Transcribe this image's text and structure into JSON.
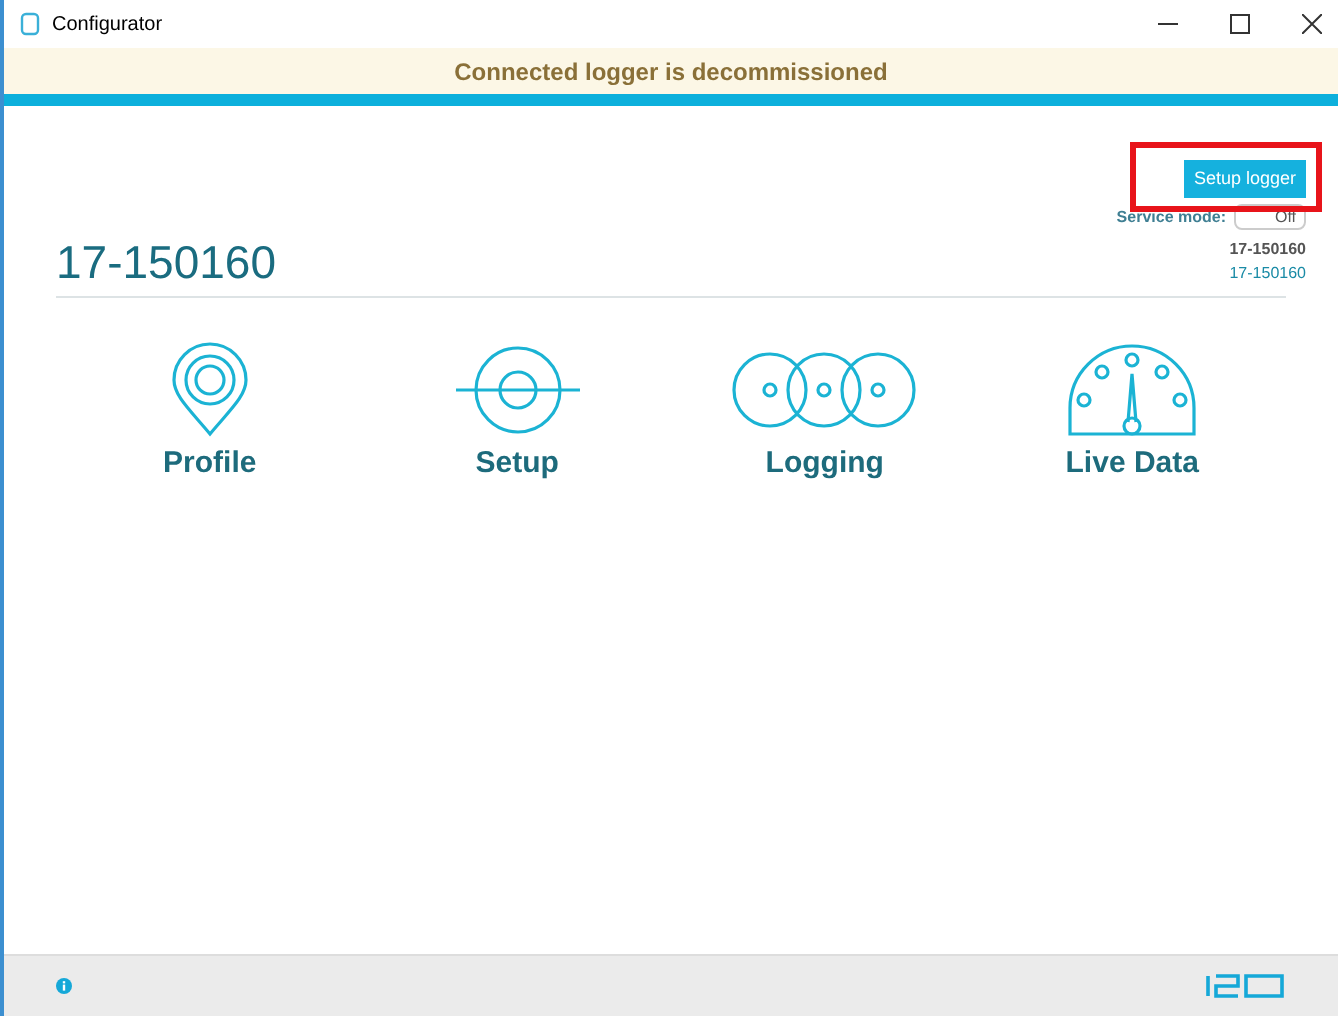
{
  "window": {
    "title": "Configurator"
  },
  "banner": {
    "text": "Connected logger is decommissioned"
  },
  "setup_button": {
    "label": "Setup logger",
    "highlighted": true
  },
  "service_mode": {
    "label": "Service mode:",
    "state": "Off",
    "on": false
  },
  "logger": {
    "title": "17-150160",
    "id": "17-150160",
    "subtitle": "17-150160"
  },
  "tiles": [
    {
      "kind": "profile",
      "label": "Profile"
    },
    {
      "kind": "setup",
      "label": "Setup"
    },
    {
      "kind": "logging",
      "label": "Logging"
    },
    {
      "kind": "live",
      "label": "Live Data"
    }
  ]
}
